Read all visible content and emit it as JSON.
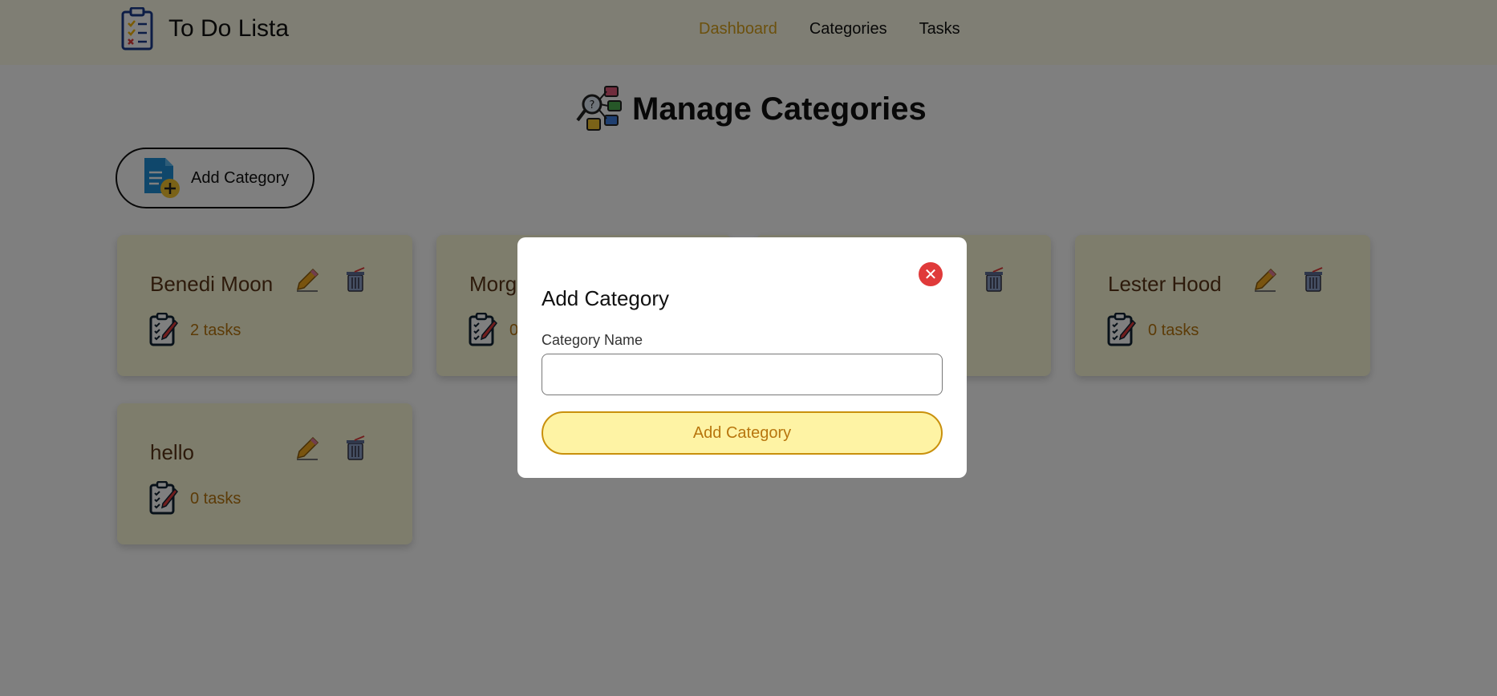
{
  "brand": {
    "title": "To Do Lista"
  },
  "nav": {
    "items": [
      "Dashboard",
      "Categories",
      "Tasks"
    ],
    "active": "Dashboard"
  },
  "page": {
    "title": "Manage Categories"
  },
  "toolbar": {
    "add_label": "Add Category"
  },
  "categories": [
    {
      "name": "Benedi Moon",
      "tasks": "2 tasks"
    },
    {
      "name": "Morg",
      "tasks": "0"
    },
    {
      "name": "",
      "tasks": ""
    },
    {
      "name": "Lester Hood",
      "tasks": "0 tasks"
    },
    {
      "name": "hello",
      "tasks": "0 tasks"
    }
  ],
  "modal": {
    "title": "Add Category",
    "field_label": "Category Name",
    "field_value": "",
    "field_placeholder": "",
    "submit_label": "Add Category"
  },
  "colors": {
    "nav_bg": "#fefde8",
    "accent": "#d9a21c",
    "card_bg": "#fcfad8",
    "danger": "#e03a3a",
    "submit_bg": "#fef3a4"
  }
}
